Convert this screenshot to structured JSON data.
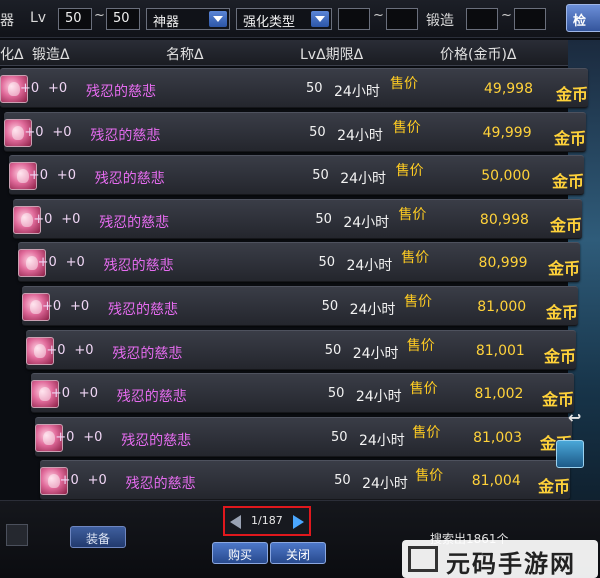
{
  "filter_bar": {
    "category_tail": "器",
    "lv_label": "Lv",
    "lv_min": "50",
    "range_sep": "~",
    "lv_max": "50",
    "rarity_select": "神器",
    "enhance_select": "强化类型",
    "refine_label": "锻造",
    "search_button": "检"
  },
  "headers": {
    "enhance": "化Δ",
    "refine": "锻造Δ",
    "name": "名称Δ",
    "lv_duration": "LvΔ期限Δ",
    "price": "价格(金币)Δ"
  },
  "rows": [
    {
      "enhance": "+0",
      "refine": "+0",
      "name": "残忍的慈悲",
      "lv": "50",
      "duration": "24小时",
      "sale": "售价",
      "price": "49,998",
      "currency": "金币"
    },
    {
      "enhance": "+0",
      "refine": "+0",
      "name": "残忍的慈悲",
      "lv": "50",
      "duration": "24小时",
      "sale": "售价",
      "price": "49,999",
      "currency": "金币"
    },
    {
      "enhance": "+0",
      "refine": "+0",
      "name": "残忍的慈悲",
      "lv": "50",
      "duration": "24小时",
      "sale": "售价",
      "price": "50,000",
      "currency": "金币"
    },
    {
      "enhance": "+0",
      "refine": "+0",
      "name": "残忍的慈悲",
      "lv": "50",
      "duration": "24小时",
      "sale": "售价",
      "price": "80,998",
      "currency": "金币"
    },
    {
      "enhance": "+0",
      "refine": "+0",
      "name": "残忍的慈悲",
      "lv": "50",
      "duration": "24小时",
      "sale": "售价",
      "price": "80,999",
      "currency": "金币"
    },
    {
      "enhance": "+0",
      "refine": "+0",
      "name": "残忍的慈悲",
      "lv": "50",
      "duration": "24小时",
      "sale": "售价",
      "price": "81,000",
      "currency": "金币"
    },
    {
      "enhance": "+0",
      "refine": "+0",
      "name": "残忍的慈悲",
      "lv": "50",
      "duration": "24小时",
      "sale": "售价",
      "price": "81,001",
      "currency": "金币"
    },
    {
      "enhance": "+0",
      "refine": "+0",
      "name": "残忍的慈悲",
      "lv": "50",
      "duration": "24小时",
      "sale": "售价",
      "price": "81,002",
      "currency": "金币"
    },
    {
      "enhance": "+0",
      "refine": "+0",
      "name": "残忍的慈悲",
      "lv": "50",
      "duration": "24小时",
      "sale": "售价",
      "price": "81,003",
      "currency": "金币"
    },
    {
      "enhance": "+0",
      "refine": "+0",
      "name": "残忍的慈悲",
      "lv": "50",
      "duration": "24小时",
      "sale": "售价",
      "price": "81,004",
      "currency": "金币"
    }
  ],
  "pagination": {
    "page": "1/187"
  },
  "footer": {
    "search_count": "搜索出1861个",
    "left_button": "装备",
    "buy_button": "购买",
    "close_button": "关闭"
  },
  "watermark": {
    "text": "元码手游网"
  },
  "icons": {
    "item": "pink-orb-icon",
    "dropdown": "chevron-down-icon",
    "prev": "triangle-left-icon",
    "next": "triangle-right-icon",
    "side_arrow": "return-arrow-icon"
  },
  "colors": {
    "item_name": "#e66cf0",
    "price": "#ffd23a",
    "pager_highlight": "#e0181d",
    "next_arrow": "#4aa7ff"
  }
}
